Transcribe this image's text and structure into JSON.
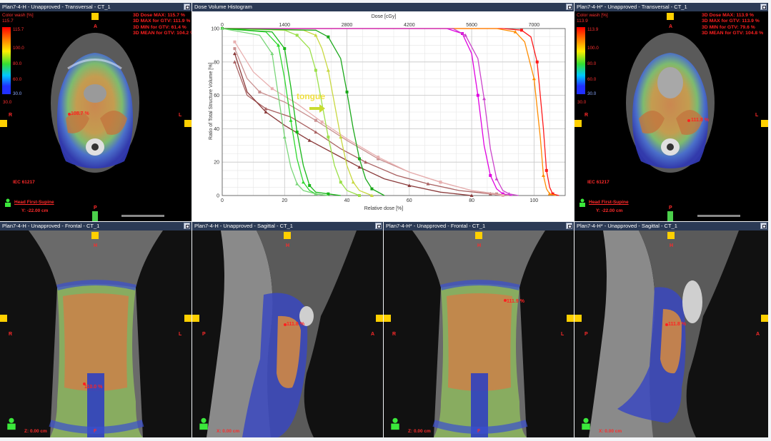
{
  "panels": {
    "tl": {
      "title": "Plan7-4-H  -  Unapproved - Transversal - CT_1",
      "stats": [
        "3D Dose MAX: 115.7 %",
        "3D MAX for GTV: 111.9 %",
        "3D MIN for GTV: 61.4 %",
        "3D MEAN for GTV: 104.2 %"
      ],
      "cw_title": "Color wash [%]",
      "cw_max": "115.7",
      "legend": [
        "115.7",
        "100.0",
        "80.0",
        "60.0",
        "30.0"
      ],
      "legend_min": "30.0",
      "dose_label": "108.7 %",
      "iec": "IEC 61217",
      "orientation": "Head First-Supine",
      "position": "Y: -22.00 cm"
    },
    "tr": {
      "title": "Plan7-4-H* - Unapproved - Transversal - CT_1",
      "stats": [
        "3D Dose MAX: 113.9 %",
        "3D MAX for GTV: 113.9 %",
        "3D MIN for GTV: 79.6 %",
        "3D MEAN for GTV: 104.8 %"
      ],
      "cw_title": "Color wash [%]",
      "cw_max": "113.9",
      "legend": [
        "113.9",
        "100.0",
        "80.0",
        "60.0",
        "30.0"
      ],
      "legend_min": "30.0",
      "dose_label": "111.8 %",
      "iec": "IEC 61217",
      "orientation": "Head First-Supine",
      "position": "Y: -22.00 cm"
    },
    "dvh": {
      "title": "Dose Volume Histogram"
    },
    "b1": {
      "title": "Plan7-4-H  -  Unapproved - Frontal - CT_1",
      "dose_label": "110.0 %",
      "position": "Z: 0.00 cm"
    },
    "b2": {
      "title": "Plan7-4-H  -  Unapproved - Sagittal - CT_1",
      "dose_label": "111.8 %",
      "position": "X: 0.00 cm"
    },
    "b3": {
      "title": "Plan7-4-H* - Unapproved - Frontal - CT_1",
      "dose_label": "111.9 %",
      "position": "Z: 0.00 cm"
    },
    "b4": {
      "title": "Plan7-4-H* - Unapproved - Sagittal - CT_1",
      "dose_label": "111.8 %",
      "position": "X: 0.00 cm"
    }
  },
  "orient": {
    "A": "A",
    "P": "P",
    "R": "R",
    "L": "L",
    "H": "H",
    "F": "F"
  },
  "annotation": "tongue",
  "chart_data": {
    "type": "line",
    "title": "",
    "xlabel": "Relative dose [%]",
    "ylabel": "Ratio of Total Structure Volume [%]",
    "x2label": "Dose [cGy]",
    "xlim": [
      0,
      110
    ],
    "ylim": [
      0,
      100
    ],
    "xticks": [
      0,
      20,
      40,
      60,
      80,
      100
    ],
    "x2ticks": [
      "0",
      "1400",
      "2800",
      "4200",
      "5600",
      "7000"
    ],
    "yticks": [
      0,
      20,
      40,
      60,
      80,
      100
    ],
    "grid": true,
    "series": [
      {
        "color": "#ff1a1a",
        "x": [
          0,
          90,
          96,
          99,
          101,
          103,
          104,
          105,
          106,
          108
        ],
        "y": [
          100,
          100,
          99,
          95,
          80,
          40,
          15,
          5,
          1,
          0
        ]
      },
      {
        "color": "#ff8c00",
        "x": [
          0,
          88,
          94,
          97,
          100,
          102,
          103,
          104,
          105,
          107
        ],
        "y": [
          100,
          100,
          98,
          92,
          70,
          35,
          12,
          4,
          1,
          0
        ]
      },
      {
        "color": "#e000e0",
        "x": [
          0,
          72,
          77,
          80,
          82,
          84,
          86,
          88,
          90,
          93
        ],
        "y": [
          100,
          100,
          97,
          85,
          60,
          30,
          12,
          4,
          1,
          0
        ]
      },
      {
        "color": "#cc44cc",
        "x": [
          0,
          74,
          78,
          82,
          84,
          86,
          88,
          90,
          92,
          95
        ],
        "y": [
          100,
          100,
          96,
          82,
          58,
          28,
          10,
          3,
          1,
          0
        ]
      },
      {
        "color": "#c99090",
        "x": [
          4,
          8,
          12,
          20,
          30,
          40,
          50,
          60,
          70,
          80,
          88,
          92
        ],
        "y": [
          88,
          70,
          62,
          56,
          45,
          33,
          22,
          14,
          8,
          3,
          1,
          0
        ]
      },
      {
        "color": "#a86060",
        "x": [
          4,
          8,
          14,
          22,
          30,
          38,
          46,
          56,
          66,
          76,
          86,
          90
        ],
        "y": [
          80,
          60,
          52,
          47,
          38,
          28,
          20,
          12,
          7,
          3,
          1,
          0
        ]
      },
      {
        "color": "#e8b0b0",
        "x": [
          4,
          10,
          16,
          24,
          32,
          40,
          50,
          60,
          70,
          80,
          90
        ],
        "y": [
          92,
          74,
          64,
          55,
          44,
          34,
          23,
          14,
          8,
          3,
          0
        ]
      },
      {
        "color": "#8a3a3a",
        "x": [
          4,
          8,
          14,
          20,
          28,
          36,
          44,
          52,
          60,
          70,
          80
        ],
        "y": [
          85,
          62,
          50,
          42,
          33,
          25,
          17,
          10,
          6,
          2,
          0
        ]
      },
      {
        "color": "#9be04a",
        "x": [
          0,
          20,
          24,
          28,
          30,
          32,
          34,
          36,
          38,
          40,
          44
        ],
        "y": [
          100,
          99,
          96,
          88,
          75,
          55,
          35,
          18,
          8,
          3,
          0
        ]
      },
      {
        "color": "#c8d840",
        "x": [
          0,
          26,
          30,
          32,
          34,
          36,
          38,
          40,
          42,
          44,
          48
        ],
        "y": [
          100,
          99,
          96,
          88,
          75,
          55,
          35,
          18,
          8,
          3,
          0
        ]
      },
      {
        "color": "#1aa81a",
        "x": [
          0,
          30,
          34,
          38,
          40,
          42,
          44,
          46,
          48,
          52
        ],
        "y": [
          100,
          99,
          95,
          82,
          62,
          40,
          22,
          10,
          4,
          0
        ]
      },
      {
        "color": "#2ed82e",
        "x": [
          0,
          14,
          18,
          20,
          22,
          24,
          26,
          28,
          30,
          34
        ],
        "y": [
          100,
          98,
          90,
          70,
          45,
          22,
          8,
          3,
          1,
          0
        ]
      },
      {
        "color": "#17b817",
        "x": [
          0,
          16,
          20,
          22,
          24,
          26,
          28,
          30,
          34,
          38
        ],
        "y": [
          100,
          98,
          88,
          65,
          38,
          18,
          6,
          2,
          1,
          0
        ]
      },
      {
        "color": "#7ad67a",
        "x": [
          0,
          12,
          16,
          18,
          20,
          22,
          24,
          26,
          30,
          34
        ],
        "y": [
          100,
          96,
          85,
          60,
          35,
          17,
          7,
          3,
          1,
          0
        ]
      }
    ]
  }
}
